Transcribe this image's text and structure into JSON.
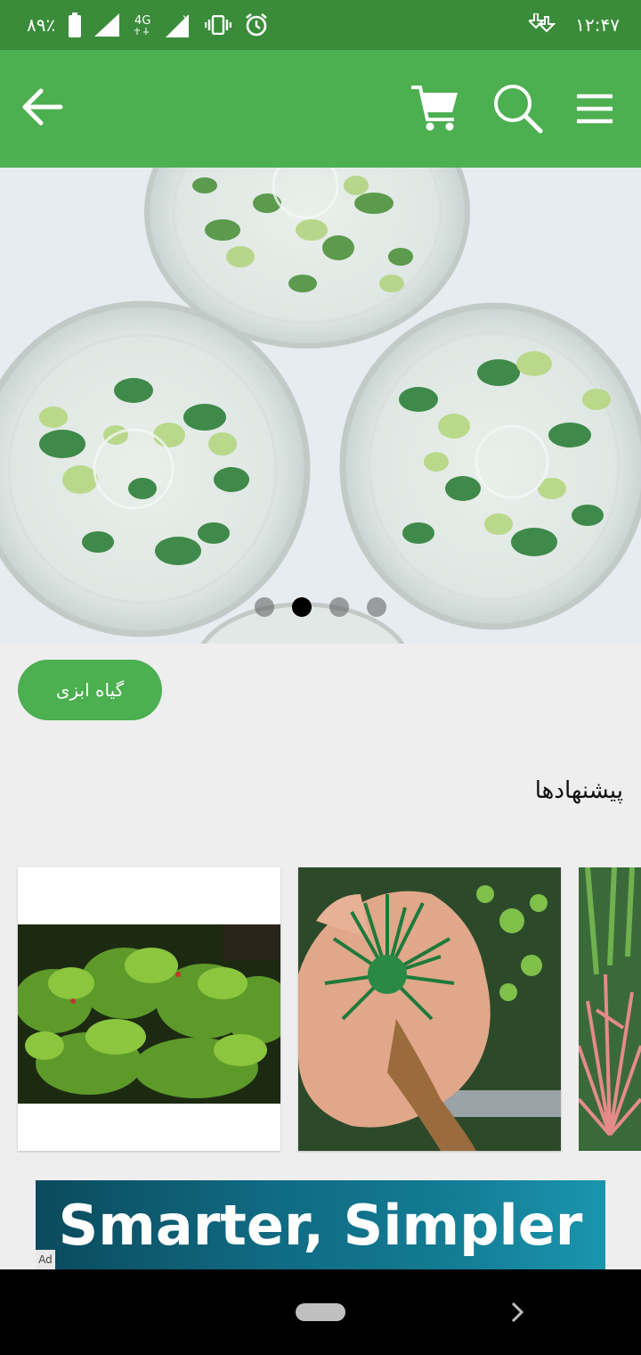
{
  "status_bar": {
    "battery_percent": "۸۹٪",
    "network": "4G",
    "time": "۱۲:۴۷",
    "icons": [
      "battery-icon",
      "signal-icon",
      "signal-4g-icon",
      "signal-no-service-icon",
      "vibrate-icon",
      "alarm-icon",
      "download-icon"
    ]
  },
  "app_bar": {
    "icons": [
      "back-arrow-icon",
      "cart-icon",
      "search-icon",
      "hamburger-menu-icon"
    ],
    "color": "#4caf50"
  },
  "hero": {
    "carousel_pages": 4,
    "active_page": 2
  },
  "category_chip": {
    "label": "گیاه ابزی"
  },
  "suggestions": {
    "title": "پیشنهادها"
  },
  "ad": {
    "text": "Smarter, Simpler",
    "badge": "Ad"
  },
  "colors": {
    "status_bar": "#3a8c3a",
    "primary": "#4caf50",
    "background": "#eeeeee"
  }
}
